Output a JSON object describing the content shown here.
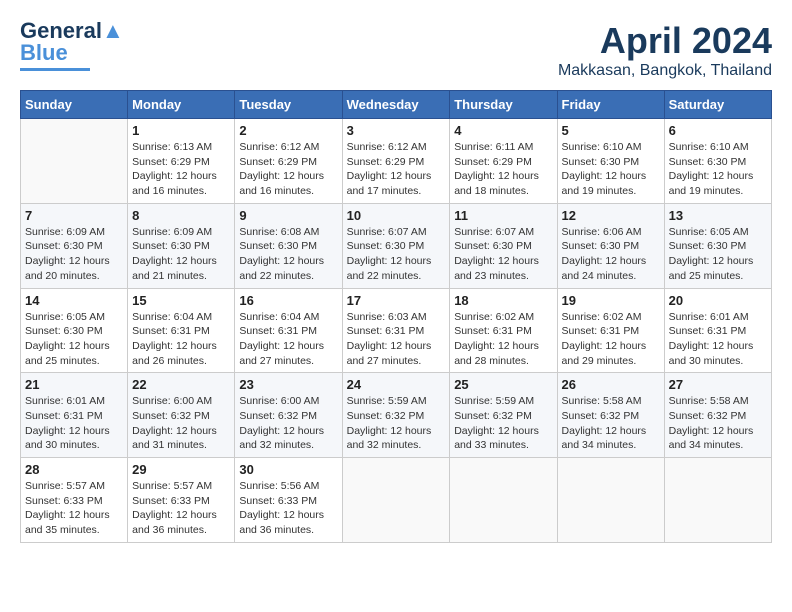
{
  "header": {
    "logo_line1": "General",
    "logo_line2": "Blue",
    "month": "April 2024",
    "location": "Makkasan, Bangkok, Thailand"
  },
  "days_of_week": [
    "Sunday",
    "Monday",
    "Tuesday",
    "Wednesday",
    "Thursday",
    "Friday",
    "Saturday"
  ],
  "weeks": [
    [
      {
        "day": "",
        "info": ""
      },
      {
        "day": "1",
        "info": "Sunrise: 6:13 AM\nSunset: 6:29 PM\nDaylight: 12 hours\nand 16 minutes."
      },
      {
        "day": "2",
        "info": "Sunrise: 6:12 AM\nSunset: 6:29 PM\nDaylight: 12 hours\nand 16 minutes."
      },
      {
        "day": "3",
        "info": "Sunrise: 6:12 AM\nSunset: 6:29 PM\nDaylight: 12 hours\nand 17 minutes."
      },
      {
        "day": "4",
        "info": "Sunrise: 6:11 AM\nSunset: 6:29 PM\nDaylight: 12 hours\nand 18 minutes."
      },
      {
        "day": "5",
        "info": "Sunrise: 6:10 AM\nSunset: 6:30 PM\nDaylight: 12 hours\nand 19 minutes."
      },
      {
        "day": "6",
        "info": "Sunrise: 6:10 AM\nSunset: 6:30 PM\nDaylight: 12 hours\nand 19 minutes."
      }
    ],
    [
      {
        "day": "7",
        "info": "Sunrise: 6:09 AM\nSunset: 6:30 PM\nDaylight: 12 hours\nand 20 minutes."
      },
      {
        "day": "8",
        "info": "Sunrise: 6:09 AM\nSunset: 6:30 PM\nDaylight: 12 hours\nand 21 minutes."
      },
      {
        "day": "9",
        "info": "Sunrise: 6:08 AM\nSunset: 6:30 PM\nDaylight: 12 hours\nand 22 minutes."
      },
      {
        "day": "10",
        "info": "Sunrise: 6:07 AM\nSunset: 6:30 PM\nDaylight: 12 hours\nand 22 minutes."
      },
      {
        "day": "11",
        "info": "Sunrise: 6:07 AM\nSunset: 6:30 PM\nDaylight: 12 hours\nand 23 minutes."
      },
      {
        "day": "12",
        "info": "Sunrise: 6:06 AM\nSunset: 6:30 PM\nDaylight: 12 hours\nand 24 minutes."
      },
      {
        "day": "13",
        "info": "Sunrise: 6:05 AM\nSunset: 6:30 PM\nDaylight: 12 hours\nand 25 minutes."
      }
    ],
    [
      {
        "day": "14",
        "info": "Sunrise: 6:05 AM\nSunset: 6:30 PM\nDaylight: 12 hours\nand 25 minutes."
      },
      {
        "day": "15",
        "info": "Sunrise: 6:04 AM\nSunset: 6:31 PM\nDaylight: 12 hours\nand 26 minutes."
      },
      {
        "day": "16",
        "info": "Sunrise: 6:04 AM\nSunset: 6:31 PM\nDaylight: 12 hours\nand 27 minutes."
      },
      {
        "day": "17",
        "info": "Sunrise: 6:03 AM\nSunset: 6:31 PM\nDaylight: 12 hours\nand 27 minutes."
      },
      {
        "day": "18",
        "info": "Sunrise: 6:02 AM\nSunset: 6:31 PM\nDaylight: 12 hours\nand 28 minutes."
      },
      {
        "day": "19",
        "info": "Sunrise: 6:02 AM\nSunset: 6:31 PM\nDaylight: 12 hours\nand 29 minutes."
      },
      {
        "day": "20",
        "info": "Sunrise: 6:01 AM\nSunset: 6:31 PM\nDaylight: 12 hours\nand 30 minutes."
      }
    ],
    [
      {
        "day": "21",
        "info": "Sunrise: 6:01 AM\nSunset: 6:31 PM\nDaylight: 12 hours\nand 30 minutes."
      },
      {
        "day": "22",
        "info": "Sunrise: 6:00 AM\nSunset: 6:32 PM\nDaylight: 12 hours\nand 31 minutes."
      },
      {
        "day": "23",
        "info": "Sunrise: 6:00 AM\nSunset: 6:32 PM\nDaylight: 12 hours\nand 32 minutes."
      },
      {
        "day": "24",
        "info": "Sunrise: 5:59 AM\nSunset: 6:32 PM\nDaylight: 12 hours\nand 32 minutes."
      },
      {
        "day": "25",
        "info": "Sunrise: 5:59 AM\nSunset: 6:32 PM\nDaylight: 12 hours\nand 33 minutes."
      },
      {
        "day": "26",
        "info": "Sunrise: 5:58 AM\nSunset: 6:32 PM\nDaylight: 12 hours\nand 34 minutes."
      },
      {
        "day": "27",
        "info": "Sunrise: 5:58 AM\nSunset: 6:32 PM\nDaylight: 12 hours\nand 34 minutes."
      }
    ],
    [
      {
        "day": "28",
        "info": "Sunrise: 5:57 AM\nSunset: 6:33 PM\nDaylight: 12 hours\nand 35 minutes."
      },
      {
        "day": "29",
        "info": "Sunrise: 5:57 AM\nSunset: 6:33 PM\nDaylight: 12 hours\nand 36 minutes."
      },
      {
        "day": "30",
        "info": "Sunrise: 5:56 AM\nSunset: 6:33 PM\nDaylight: 12 hours\nand 36 minutes."
      },
      {
        "day": "",
        "info": ""
      },
      {
        "day": "",
        "info": ""
      },
      {
        "day": "",
        "info": ""
      },
      {
        "day": "",
        "info": ""
      }
    ]
  ]
}
